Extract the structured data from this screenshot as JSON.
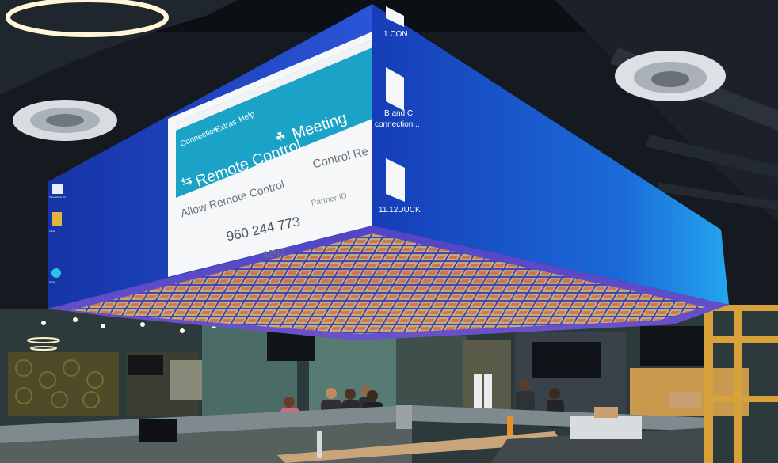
{
  "main_screen": {
    "menu": [
      "Connection",
      "Extras",
      "Help"
    ],
    "remote_control_label": "Remote Control",
    "meeting_label": "Meeting",
    "allow_remote_control": "Allow Remote Control",
    "control_remote": "Control Re",
    "partner_id": "Partner ID",
    "id_number": "960 244 773",
    "partial_number": "4203"
  },
  "right_screen": {
    "desktop_icons": [
      {
        "icon": "file-icon",
        "label_lines": [
          "1.CON"
        ]
      },
      {
        "icon": "file-icon",
        "label_lines": [
          "B and C",
          "connection..."
        ]
      },
      {
        "icon": "file-icon",
        "label_lines": [
          "11.12DUCK"
        ]
      }
    ]
  },
  "left_screen": {
    "desktop_icons": [
      {
        "icon": "teamviewer-icon",
        "label": "TeamViewer 13"
      },
      {
        "icon": "folder-icon",
        "label": "Folder"
      },
      {
        "icon": "skype-icon",
        "label": "Skype"
      }
    ]
  },
  "colors": {
    "screen_blue": "#1d3fae",
    "teamviewer_blue": "#1aa3c6",
    "ceiling_dark": "#1a1f26",
    "counter_wood": "#caa57a"
  }
}
